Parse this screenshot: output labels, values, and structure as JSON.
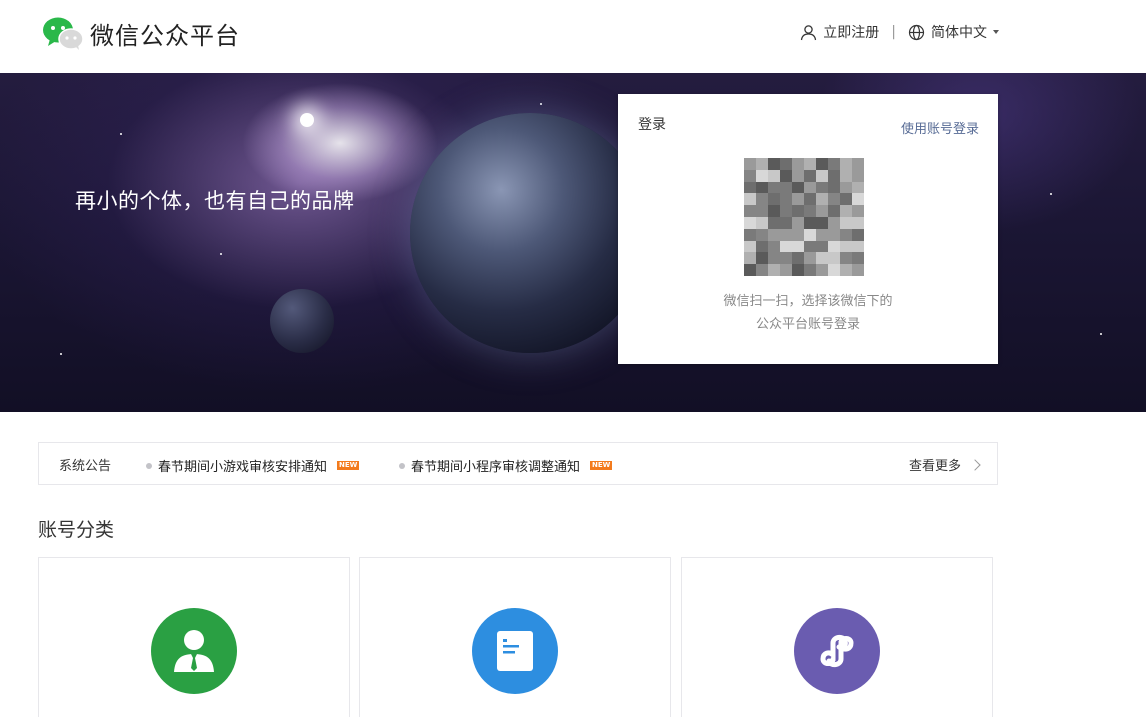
{
  "header": {
    "logo_text": "微信公众平台",
    "register_label": "立即注册",
    "separator": "|",
    "language_label": "简体中文"
  },
  "banner": {
    "slogan": "再小的个体，也有自己的品牌"
  },
  "login": {
    "title": "登录",
    "switch_label": "使用账号登录",
    "hint_line1": "微信扫一扫，选择该微信下的",
    "hint_line2": "公众平台账号登录"
  },
  "notice": {
    "label": "系统公告",
    "items": [
      {
        "text": "春节期间小游戏审核安排通知",
        "badge": "NEW"
      },
      {
        "text": "春节期间小程序审核调整通知",
        "badge": "NEW"
      }
    ],
    "more_label": "查看更多"
  },
  "accounts": {
    "title": "账号分类",
    "cards": [
      {
        "icon": "person-tie-icon",
        "color": "#2aa043"
      },
      {
        "icon": "document-icon",
        "color": "#2d8ee0"
      },
      {
        "icon": "mini-program-icon",
        "color": "#6a5cb0"
      }
    ]
  },
  "colors": {
    "link": "#576b95",
    "badge": "#f37b1d",
    "wechat_green": "#2ab84a"
  }
}
